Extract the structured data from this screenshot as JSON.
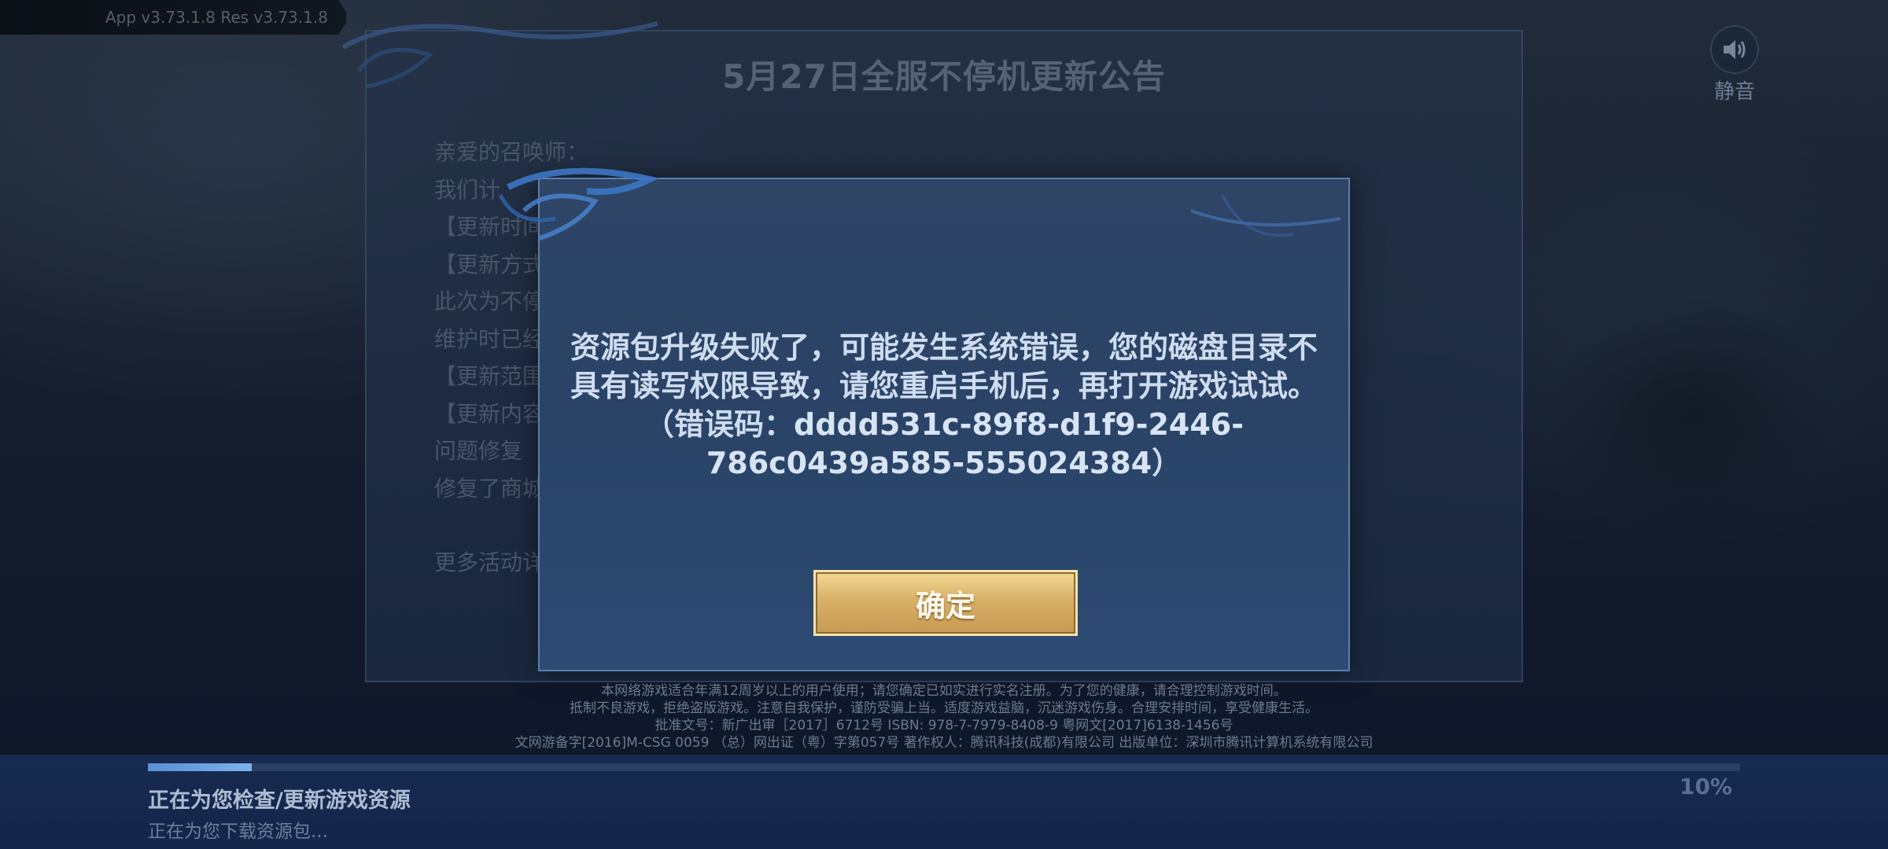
{
  "version": {
    "text": "App v3.73.1.8   Res v3.73.1.8"
  },
  "mute": {
    "label": "静音",
    "icon": "speaker-icon"
  },
  "notice": {
    "title": "5月27日全服不停机更新公告",
    "lines": [
      "亲爱的召唤师：",
      "我们计",
      "【更新时间",
      "【更新方式",
      "此次为不停",
      "维护时已经",
      "【更新范围",
      "【更新内容",
      "问题修复",
      "修复了商城",
      "更多活动详"
    ]
  },
  "modal": {
    "message": "资源包升级失败了，可能发生系统错误，您的磁盘目录不具有读写权限导致，请您重启手机后，再打开游戏试试。（错误码：",
    "error_code": "dddd531c-89f8-d1f9-2446-786c0439a585-555024384",
    "message_end": "）",
    "confirm_label": "确定"
  },
  "legal": {
    "lines": [
      "本网络游戏适合年满12周岁以上的用户使用；请您确定已如实进行实名注册。为了您的健康，请合理控制游戏时间。",
      "抵制不良游戏，拒绝盗版游戏。注意自我保护，谨防受骗上当。适度游戏益脑，沉迷游戏伤身。合理安排时间，享受健康生活。",
      "批准文号：新广出审［2017］6712号  ISBN: 978-7-7979-8408-9  粤网文[2017]6138-1456号",
      "文网游备字[2016]M-CSG 0059 （总）网出证（粤）字第057号  著作权人：腾讯科技(成都)有限公司  出版单位：深圳市腾讯计算机系统有限公司"
    ]
  },
  "loader": {
    "status_main": "正在为您检查/更新游戏资源",
    "status_sub": "正在为您下载资源包...",
    "percent_text": "10%",
    "progress": 0.065
  }
}
